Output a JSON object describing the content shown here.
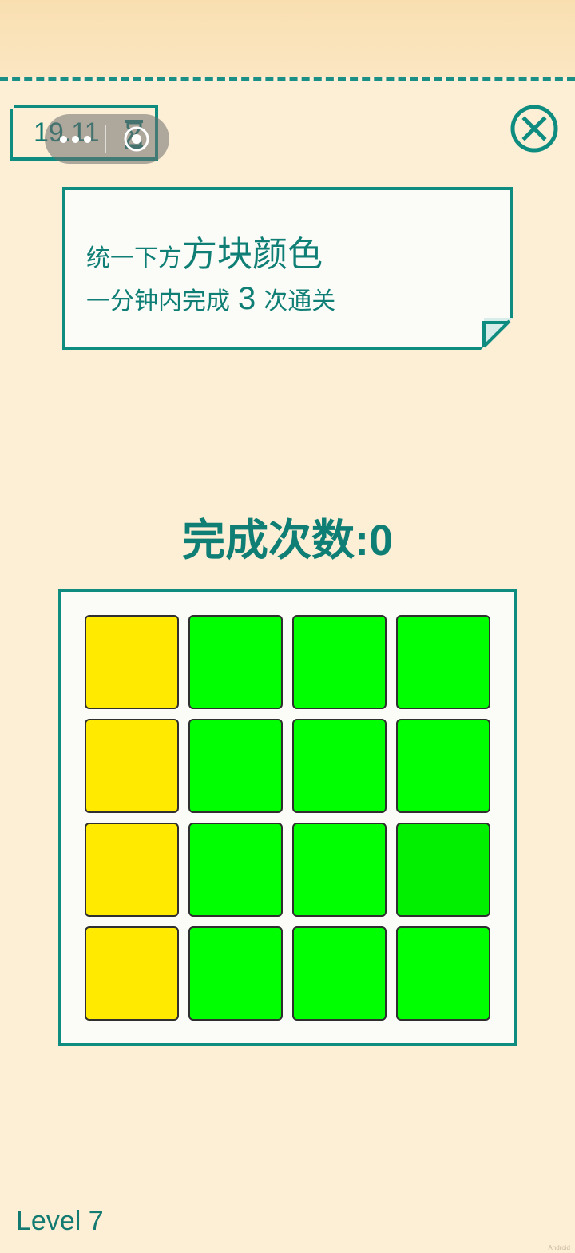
{
  "timer": {
    "value": "19.11",
    "icon": "hourglass-icon"
  },
  "capsule": {
    "more_icon": "more-dots-icon",
    "close_icon": "target-close-icon"
  },
  "close_button": {
    "icon": "close-x-icon"
  },
  "instruction": {
    "line1_small": "统一下方",
    "line1_big": "方块颜色",
    "line2_before": "一分钟内完成",
    "line2_number": "3",
    "line2_after": "次通关"
  },
  "counter": {
    "text": "完成次数:0"
  },
  "board": {
    "rows": 4,
    "cols": 4,
    "colors": {
      "yellow": "#ffea00",
      "green": "#00ff00",
      "green_dark": "#00f000"
    },
    "tiles": [
      [
        "yellow",
        "green",
        "green",
        "green"
      ],
      [
        "yellow",
        "green",
        "green",
        "green"
      ],
      [
        "yellow",
        "green",
        "green",
        "green_dark"
      ],
      [
        "yellow",
        "green",
        "green",
        "green"
      ]
    ]
  },
  "level": {
    "label": "Level 7"
  },
  "theme": {
    "background": "#fdefd5",
    "accent": "#0f8c80",
    "text": "#0f7f76"
  }
}
